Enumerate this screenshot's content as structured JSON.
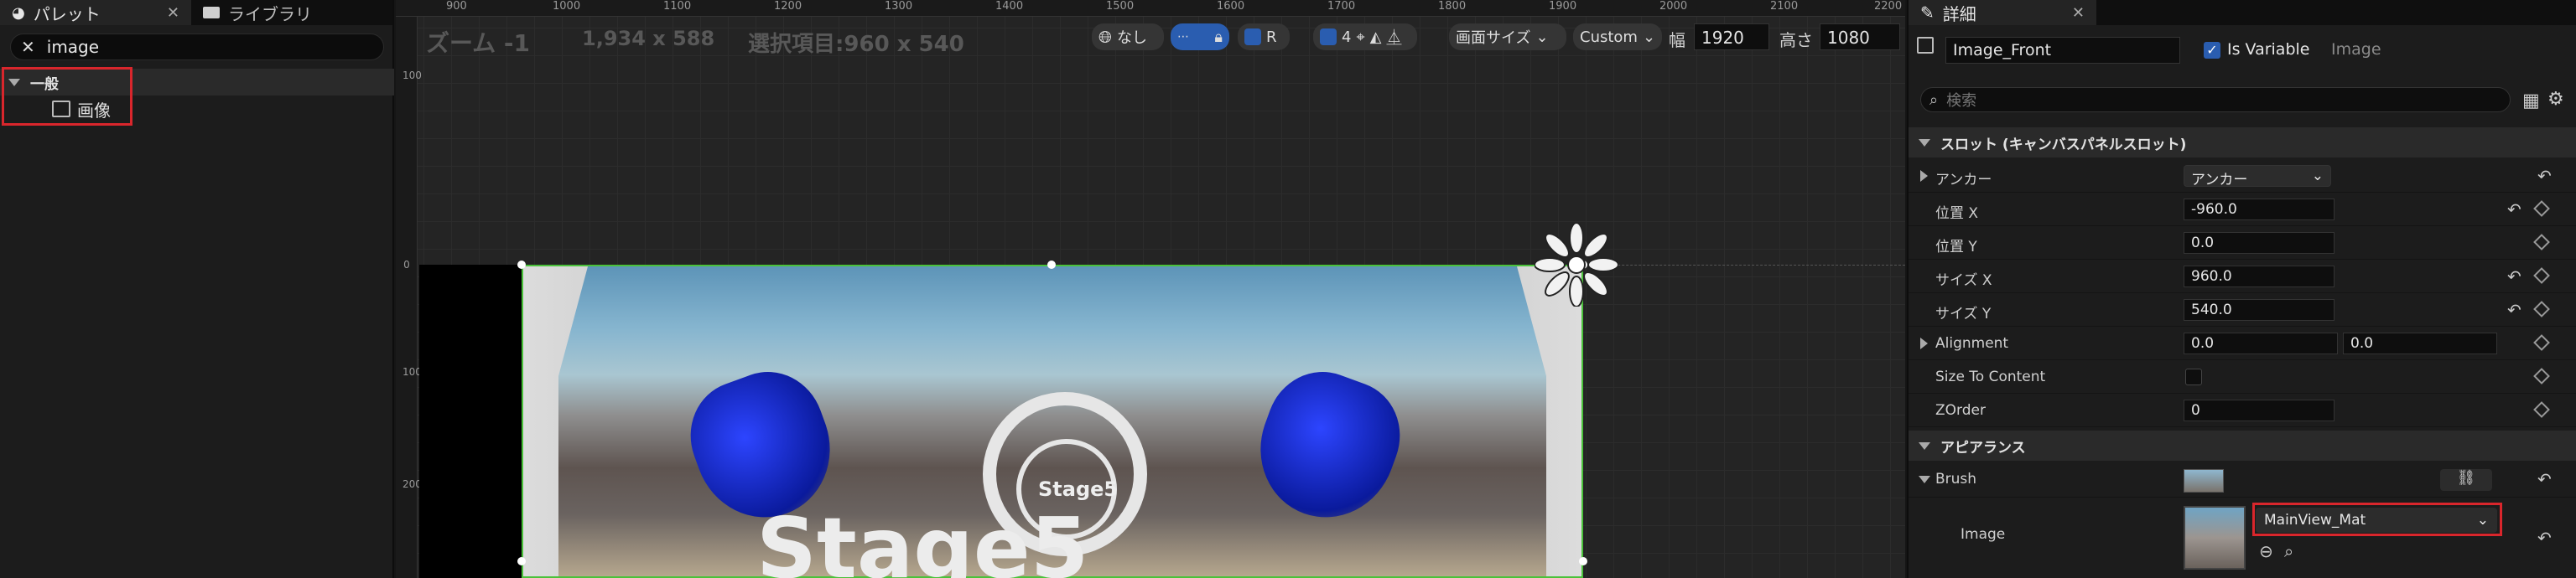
{
  "palette": {
    "tab_label": "パレット",
    "library_tab_label": "ライブラリ",
    "search_value": "image",
    "category_label": "一般",
    "item_label": "画像"
  },
  "designer": {
    "ruler_top": [
      "900",
      "1000",
      "1100",
      "1200",
      "1300",
      "1400",
      "1500",
      "1600",
      "1700",
      "1800",
      "1900",
      "2000",
      "2100",
      "2200"
    ],
    "ruler_left": [
      "100",
      "0",
      "100",
      "200"
    ],
    "zoom_label": "ズーム -1",
    "resolution_label": "1,934 x 588",
    "selection_label": "選択項目:960 x 540",
    "toolbar": {
      "none_label": "なし",
      "r_label": "R",
      "grid_count": "4",
      "screen_size_label": "画面サイズ",
      "custom_label": "Custom",
      "width_label": "幅",
      "width_value": "1920",
      "height_label": "高さ",
      "height_value": "1080"
    },
    "stage_text": "Stage5",
    "stage_small_text": "Stage5"
  },
  "details": {
    "tab_label": "詳細",
    "widget_name": "Image_Front",
    "is_variable_label": "Is Variable",
    "widget_type": "Image",
    "search_placeholder": "検索",
    "slot_section": "スロット (キャンバスパネルスロット)",
    "rows": {
      "anchor_label": "アンカー",
      "anchor_value": "アンカー",
      "pos_x_label": "位置 X",
      "pos_x_value": "-960.0",
      "pos_y_label": "位置 Y",
      "pos_y_value": "0.0",
      "size_x_label": "サイズ X",
      "size_x_value": "960.0",
      "size_y_label": "サイズ Y",
      "size_y_value": "540.0",
      "alignment_label": "Alignment",
      "alignment_x": "0.0",
      "alignment_y": "0.0",
      "size_to_content_label": "Size To Content",
      "zorder_label": "ZOrder",
      "zorder_value": "0"
    },
    "appearance_section": "アピアランス",
    "brush_label": "Brush",
    "image_label": "Image",
    "material_value": "MainView_Mat"
  }
}
